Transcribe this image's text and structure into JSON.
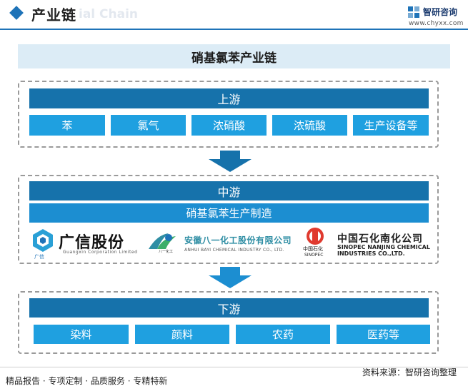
{
  "header": {
    "title": "产业链",
    "watermark": "ial Chain",
    "brand_name": "智研咨询",
    "brand_url": "www.chyxx.com"
  },
  "banner": {
    "title": "硝基氯苯产业链"
  },
  "upstream": {
    "label": "上游",
    "items": [
      "苯",
      "氯气",
      "浓硝酸",
      "浓硫酸",
      "生产设备等"
    ]
  },
  "midstream": {
    "label": "中游",
    "process": "硝基氯苯生产制造",
    "companies": {
      "guangxin": {
        "name_cn": "广信股份",
        "name_en": "Guangxin Corporation Limited",
        "mark_text": "广信"
      },
      "bayi": {
        "name_cn": "安徽八一化工股份有限公司",
        "name_en": "ANHUI BAYI CHEMICAL INDUSTRY CO., LTD.",
        "mark_text": "八一化工"
      },
      "sinopec": {
        "name_cn": "中国石化南化公司",
        "name_en_line1": "SINOPEC NANJING CHEMICAL",
        "name_en_line2": "INDUSTRIES CO.,LTD.",
        "mark_cn": "中国石化",
        "mark_en": "SINOPEC"
      }
    }
  },
  "downstream": {
    "label": "下游",
    "items": [
      "染料",
      "颜料",
      "农药",
      "医药等"
    ]
  },
  "footer": {
    "left": "精品报告 · 专项定制 · 品质服务 · 专精特新",
    "right": "资料来源：智研咨询整理"
  },
  "colors": {
    "dark_bar": "#1672ab",
    "process_bar": "#1c8ed1",
    "cell": "#1fa0e0",
    "banner_bg": "#dcecf6",
    "accent": "#1e73b8"
  }
}
